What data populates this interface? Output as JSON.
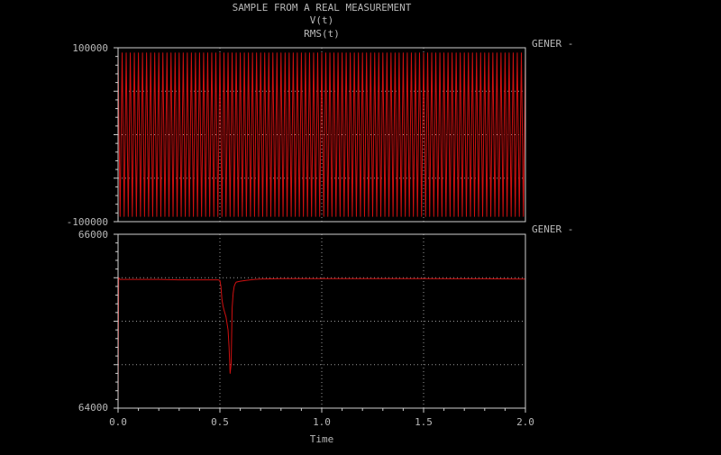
{
  "colors": {
    "background": "#000000",
    "frame": "#cfcfcf",
    "grid": "#9a9a9a",
    "text": "#b8b8b8",
    "trace": "#d01010"
  },
  "chart_data": {
    "title_lines": [
      "SAMPLE FROM A REAL MEASUREMENT",
      "V(t)",
      "RMS(t)"
    ],
    "xlabel": "Time",
    "xlim": [
      0,
      2.0
    ],
    "xticks": [
      0.0,
      0.5,
      1.0,
      1.5,
      2.0
    ],
    "xtick_labels": [
      "0.0",
      "0.5",
      "1.0",
      "1.5",
      "2.0"
    ],
    "grid": true,
    "panels": [
      {
        "type": "line",
        "panel_label": "GENER -",
        "ylim": [
          -100000,
          100000
        ],
        "ytick_labels": [
          "100000",
          "-100000"
        ],
        "series": [
          {
            "signal": "V(t)",
            "waveform": "sine",
            "frequency_hz": 50,
            "amplitude": 94000,
            "x_range": [
              0,
              2.0
            ]
          }
        ]
      },
      {
        "type": "line",
        "panel_label": "GENER -",
        "ylim": [
          64000,
          66000
        ],
        "ytick_labels": [
          "66000",
          "64000"
        ],
        "series": [
          {
            "signal": "RMS(t)",
            "x": [
              0.0,
              0.003,
              0.01,
              0.02,
              0.1,
              0.2,
              0.3,
              0.4,
              0.49,
              0.5,
              0.505,
              0.51,
              0.515,
              0.52,
              0.53,
              0.54,
              0.545,
              0.55,
              0.555,
              0.56,
              0.565,
              0.57,
              0.575,
              0.58,
              0.6,
              0.63,
              0.67,
              0.7,
              0.8,
              0.9,
              1.0,
              1.2,
              1.5,
              1.8,
              2.0
            ],
            "y": [
              64000,
              65500,
              65480,
              65480,
              65480,
              65480,
              65475,
              65475,
              65475,
              65470,
              65400,
              65250,
              65180,
              65130,
              65050,
              64900,
              64700,
              64400,
              64500,
              65150,
              65320,
              65400,
              65430,
              65450,
              65460,
              65470,
              65480,
              65485,
              65490,
              65490,
              65490,
              65490,
              65490,
              65488,
              65485
            ]
          }
        ]
      }
    ]
  }
}
